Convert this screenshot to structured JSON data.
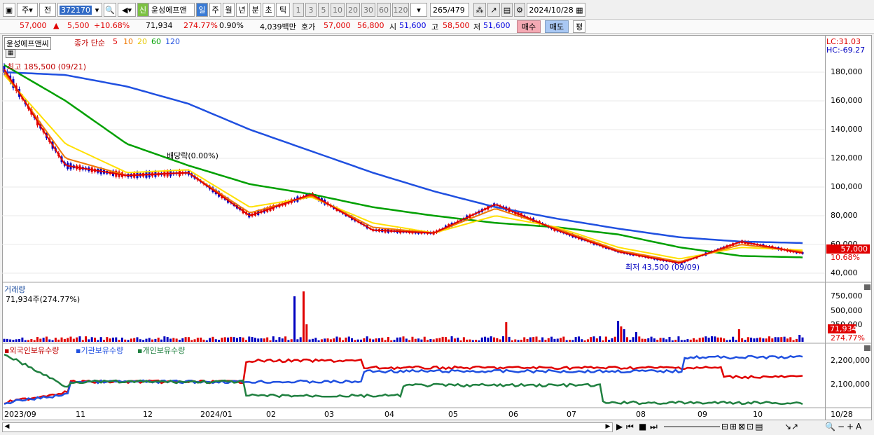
{
  "toolbar": {
    "period_day": "주",
    "prev": "전",
    "code": "372170",
    "stock_name": "윤성에프앤",
    "new_badge": "신",
    "periods": [
      "일",
      "주",
      "월",
      "년",
      "분",
      "초",
      "틱"
    ],
    "nums": [
      "1",
      "3",
      "5",
      "10",
      "20",
      "30",
      "60",
      "120"
    ],
    "count_shown": "265",
    "count_total": "/479",
    "date": "2024/10/28"
  },
  "price_row": {
    "price": "57,000",
    "arrow": "▲",
    "change": "5,500",
    "change_pct": "+10.68%",
    "volume": "71,934",
    "volume_pct": "274.77%",
    "turnover": "0.90%",
    "amount": "4,039백만",
    "quote_label": "호가",
    "ask": "57,000",
    "bid": "56,800",
    "open_label": "시",
    "open": "51,600",
    "high_label": "고",
    "high": "58,500",
    "low_label": "저",
    "low": "51,600",
    "buy_label": "매수",
    "sell_label": "매도",
    "eval_label": "평"
  },
  "price_panel": {
    "title": "윤성에프앤씨",
    "ma_label": "종가 단순",
    "ma5": "5",
    "ma10": "10",
    "ma20": "20",
    "ma60": "60",
    "ma120": "120",
    "high_note": "최고 185,500 (09/21)",
    "low_note": "최저 43,500 (09/09)",
    "dividend_note": "배당락(0.00%)",
    "lc": "LC:31.03",
    "hc": "HC:-69.27",
    "yticks": [
      "180,000",
      "160,000",
      "140,000",
      "120,000",
      "100,000",
      "80,000",
      "60,000",
      "40,000"
    ],
    "current_tag": "57,000",
    "pct_tag": "10.68%"
  },
  "volume_panel": {
    "title": "거래량",
    "value": "71,934주(274.77%)",
    "yticks": [
      "750,000",
      "500,000",
      "250,000"
    ],
    "current_tag": "71,934",
    "pct_tag": "274.77%"
  },
  "holding_panel": {
    "foreign": "외국인보유수량",
    "inst": "기관보유수량",
    "indiv": "개인보유수량",
    "yticks": [
      "2,200,000",
      "2,100,000"
    ]
  },
  "xaxis": [
    "2023/09",
    "11",
    "12",
    "2024/01",
    "02",
    "03",
    "04",
    "05",
    "06",
    "07",
    "08",
    "09",
    "10",
    "10/28"
  ],
  "colors": {
    "up": "#e00000",
    "down": "#0000c0",
    "ma5": "#e00000",
    "ma10": "#f07800",
    "ma20": "#ffe000",
    "ma60": "#00a000",
    "ma120": "#2050e0"
  },
  "chart_data": {
    "type": "line",
    "title": "윤성에프앤씨",
    "x": [
      "2023/09",
      "11",
      "12",
      "2024/01",
      "02",
      "03",
      "04",
      "05",
      "06",
      "07",
      "08",
      "09",
      "10",
      "10/28"
    ],
    "series": [
      {
        "name": "5",
        "values": [
          182000,
          115000,
          108000,
          110000,
          80000,
          95000,
          70000,
          68000,
          88000,
          70000,
          55000,
          47000,
          62000,
          54000
        ]
      },
      {
        "name": "10",
        "values": [
          180000,
          120000,
          108000,
          110000,
          82000,
          94000,
          72000,
          68000,
          85000,
          71000,
          56000,
          48000,
          60000,
          55000
        ]
      },
      {
        "name": "20",
        "values": [
          178000,
          130000,
          110000,
          112000,
          86000,
          93000,
          75000,
          68000,
          80000,
          72000,
          58000,
          50000,
          58000,
          56000
        ]
      },
      {
        "name": "60",
        "values": [
          185000,
          160000,
          130000,
          115000,
          102000,
          95000,
          86000,
          80000,
          75000,
          72000,
          67000,
          58000,
          52000,
          51000
        ]
      },
      {
        "name": "120",
        "values": [
          180000,
          178000,
          170000,
          158000,
          140000,
          125000,
          110000,
          97000,
          86000,
          78000,
          71000,
          65000,
          62000,
          61000
        ]
      }
    ],
    "ylim": [
      40000,
      190000
    ],
    "ylabel": "",
    "xlabel": ""
  }
}
